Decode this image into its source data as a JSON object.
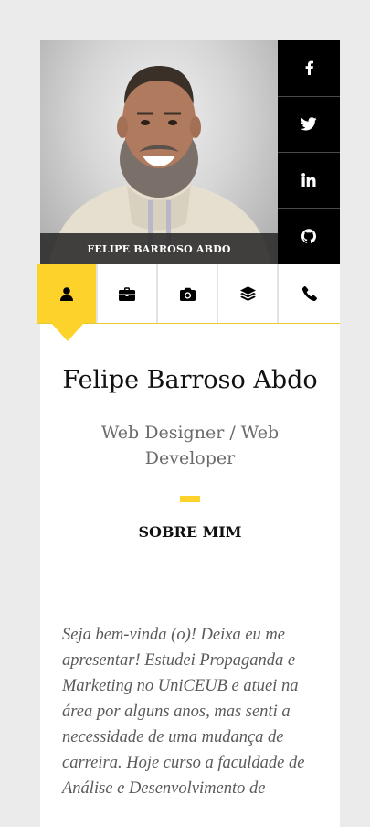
{
  "profile": {
    "photo_caption": "FELIPE BARROSO ABDO",
    "name": "Felipe Barroso Abdo",
    "role": "Web Designer / Web Developer"
  },
  "social": [
    {
      "icon": "facebook-icon"
    },
    {
      "icon": "twitter-icon"
    },
    {
      "icon": "linkedin-icon"
    },
    {
      "icon": "github-icon"
    }
  ],
  "tabs": [
    {
      "icon": "user-icon",
      "active": true
    },
    {
      "icon": "briefcase-icon",
      "active": false
    },
    {
      "icon": "camera-icon",
      "active": false
    },
    {
      "icon": "layers-icon",
      "active": false
    },
    {
      "icon": "phone-icon",
      "active": false
    }
  ],
  "about": {
    "title": "SOBRE MIM",
    "text": "Seja bem-vinda (o)! Deixa eu me apresentar! Estudei Propaganda e Marketing no UniCEUB e atuei na área por alguns anos, mas senti a necessidade de uma mudança de carreira. Hoje curso a faculdade de Análise e Desenvolvimento de"
  },
  "colors": {
    "accent": "#fdd22a",
    "social_bg": "#000000",
    "page_bg": "#ebebeb"
  }
}
